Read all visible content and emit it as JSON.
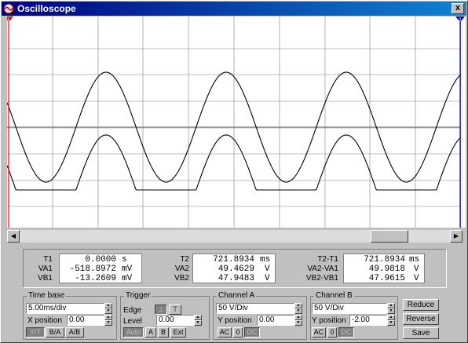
{
  "window": {
    "title": "Oscilloscope",
    "close_label": "x"
  },
  "screen": {
    "cursor1_label": "1",
    "cursor2_label": "2",
    "grid_color": "#808080",
    "background": "#ffffff",
    "trace_color": "#000000",
    "cursor1_color": "#ff0000",
    "cursor2_color": "#0000ff"
  },
  "scrollbar": {
    "left_icon": "left-arrow-icon",
    "right_icon": "right-arrow-icon"
  },
  "readouts": {
    "cursor1": {
      "t_label": "T1",
      "t_value": "0.0000",
      "t_unit": "s",
      "va_label": "VA1",
      "va_value": "-518.8972",
      "va_unit": "mV",
      "vb_label": "VB1",
      "vb_value": "-13.2609",
      "vb_unit": "mV"
    },
    "cursor2": {
      "t_label": "T2",
      "t_value": "721.8934",
      "t_unit": "ms",
      "va_label": "VA2",
      "va_value": "49.4629",
      "va_unit": "V",
      "vb_label": "VB2",
      "vb_value": "47.9483",
      "vb_unit": "V"
    },
    "diff": {
      "t_label": "T2-T1",
      "t_value": "721.8934",
      "t_unit": "ms",
      "va_label": "VA2-VA1",
      "va_value": "49.9818",
      "va_unit": "V",
      "vb_label": "VB2-VB1",
      "vb_value": "47.9615",
      "vb_unit": "V"
    }
  },
  "timebase": {
    "title": "Time base",
    "value": "5.00ms/div",
    "xpos_label": "X position",
    "xpos_value": "0.00",
    "yt_label": "Y/T",
    "ba_label": "B/A",
    "ab_label": "A/B"
  },
  "trigger": {
    "title": "Trigger",
    "edge_label": "Edge",
    "level_label": "Level",
    "level_value": "0.00",
    "auto_label": "Auto",
    "a_label": "A",
    "b_label": "B",
    "ext_label": "Ext"
  },
  "channel_a": {
    "title": "Channel A",
    "value": "50 V/Div",
    "ypos_label": "Y position",
    "ypos_value": "0.00",
    "ac_label": "AC",
    "zero_label": "0",
    "dc_label": "DC"
  },
  "channel_b": {
    "title": "Channel B",
    "value": "50 V/Div",
    "ypos_label": "Y position",
    "ypos_value": "-2.00",
    "ac_label": "AC",
    "zero_label": "0",
    "dc_label": "DC"
  },
  "buttons": {
    "reduce": "Reduce",
    "reverse": "Reverse",
    "save": "Save"
  }
}
